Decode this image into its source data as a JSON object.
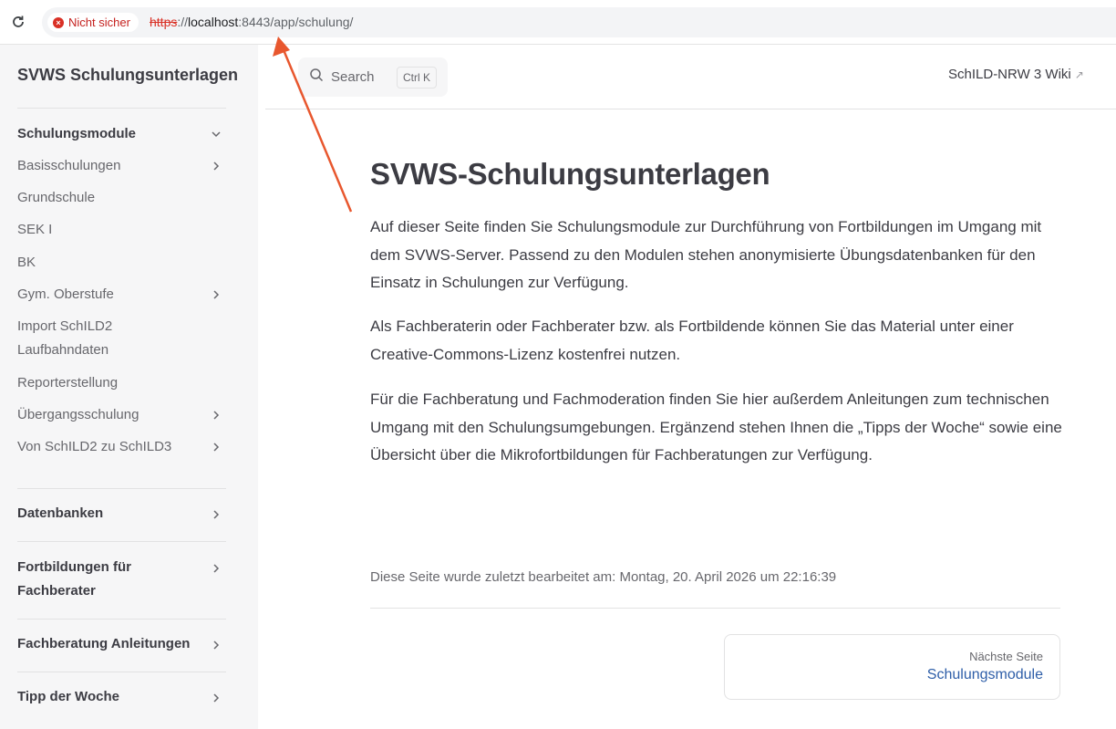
{
  "browser": {
    "security_label": "Nicht sicher",
    "url_scheme": "https",
    "url_sep": "://",
    "url_host": "localhost",
    "url_rest": ":8443/app/schulung/",
    "reload_icon": "reload-icon",
    "security_icon": "error-circle-icon"
  },
  "sidebar": {
    "site_title": "SVWS Schulungsunterlagen",
    "groups": [
      {
        "title": "Schulungsmodule",
        "expanded": true,
        "items": [
          {
            "label": "Basisschulungen",
            "has_children": true
          },
          {
            "label": "Grundschule",
            "has_children": false
          },
          {
            "label": "SEK I",
            "has_children": false
          },
          {
            "label": "BK",
            "has_children": false
          },
          {
            "label": "Gym. Oberstufe",
            "has_children": true
          },
          {
            "label": "Import SchILD2 Laufbahndaten",
            "has_children": false
          },
          {
            "label": "Reporterstellung",
            "has_children": false
          },
          {
            "label": "Übergangsschulung",
            "has_children": true
          },
          {
            "label": "Von SchILD2 zu SchILD3",
            "has_children": true
          }
        ]
      },
      {
        "title": "Datenbanken",
        "expanded": false
      },
      {
        "title": "Fortbildungen für Fachberater",
        "expanded": false
      },
      {
        "title": "Fachberatung Anleitungen",
        "expanded": false
      },
      {
        "title": "Tipp der Woche",
        "expanded": false
      }
    ]
  },
  "header": {
    "search_label": "Search",
    "search_shortcut": "Ctrl K",
    "wiki_link": "SchILD-NRW 3 Wiki",
    "wiki_link_icon": "external-link-icon"
  },
  "main": {
    "title": "SVWS-Schulungsunterlagen",
    "paragraphs": [
      "Auf dieser Seite finden Sie Schulungsmodule zur Durchführung von Fortbildungen im Umgang mit dem SVWS-Server. Passend zu den Modulen stehen anonymisierte Übungsdatenbanken für den Einsatz in Schulungen zur Verfügung.",
      "Als Fachberaterin oder Fachberater bzw. als Fortbildende können Sie das Material unter einer Creative-Commons-Lizenz kostenfrei nutzen.",
      "Für die Fachberatung und Fachmoderation finden Sie hier außerdem Anleitungen zum technischen Umgang mit den Schulungsumgebungen. Ergänzend stehen Ihnen die „Tipps der Woche“ sowie eine Übersicht über die Mikrofortbildungen für Fachberatungen zur Verfügung."
    ],
    "last_updated": "Diese Seite wurde zuletzt bearbeitet am: Montag, 20. April 2026 um 22:16:39",
    "next_page_desc": "Nächste Seite",
    "next_page_title": "Schulungsmodule"
  },
  "colors": {
    "accent_link": "#2e5ea8",
    "annotation_arrow": "#e8572e",
    "insecure_red": "#d93025"
  }
}
